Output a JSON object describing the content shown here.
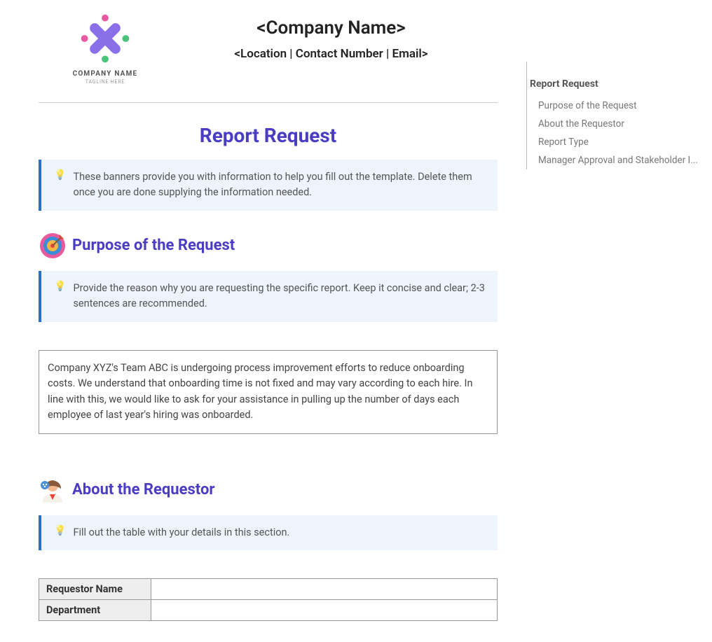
{
  "header": {
    "company_name": "<Company Name>",
    "contact_line": "<Location | Contact Number | Email>",
    "logo_name": "COMPANY NAME",
    "logo_tagline": "TAGLINE HERE"
  },
  "title": "Report Request",
  "banner_intro": "These banners provide you with information to help you fill out the template. Delete them once you are done supplying the information needed.",
  "section_purpose": {
    "heading": "Purpose of the Request",
    "banner": "Provide the reason why you are requesting the specific report. Keep it concise and clear; 2-3 sentences are recommended.",
    "body": "Company XYZ's Team ABC is undergoing process improvement efforts to reduce onboarding costs. We understand that onboarding time is not fixed and may vary according to each hire. In line with this, we would like to ask for your assistance in pulling up the number of days each employee of last year's hiring was onboarded."
  },
  "section_requestor": {
    "heading": "About the Requestor",
    "banner": "Fill out the table with your details in this section.",
    "rows": {
      "name": "Requestor Name",
      "dept": "Department"
    }
  },
  "outline": {
    "title": "Report Request",
    "items": [
      "Purpose of the Request",
      "About the Requestor",
      "Report Type",
      "Manager Approval and Stakeholder I..."
    ]
  }
}
